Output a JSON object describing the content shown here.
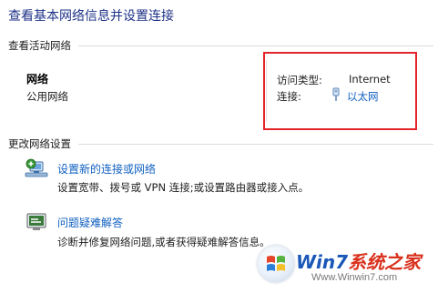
{
  "header": {
    "title": "查看基本网络信息并设置连接"
  },
  "active_networks": {
    "section_label": "查看活动网络",
    "network": {
      "name": "网络",
      "category": "公用网络",
      "access_type_label": "访问类型:",
      "access_type_value": "Internet",
      "connections_label": "连接:",
      "connection_link": "以太网"
    }
  },
  "change_settings": {
    "section_label": "更改网络设置",
    "tasks": [
      {
        "icon": "network-setup-icon",
        "link": "设置新的连接或网络",
        "description": "设置宽带、拨号或 VPN 连接;或设置路由器或接入点。"
      },
      {
        "icon": "troubleshoot-icon",
        "link": "问题疑难解答",
        "description": "诊断并修复网络问题,或者获得疑难解答信息。"
      }
    ]
  },
  "watermark": {
    "logo_icon": "windows-flag-logo",
    "brand_part1": "Win7",
    "brand_part2": "系统之家",
    "url": "Www.Winwin7.com",
    "colors": {
      "brand_blue": "#1a57b8",
      "brand_red": "#d9301c"
    }
  },
  "colors": {
    "title": "#1e3287",
    "link": "#1060c0",
    "highlight_box": "#e3242b"
  }
}
